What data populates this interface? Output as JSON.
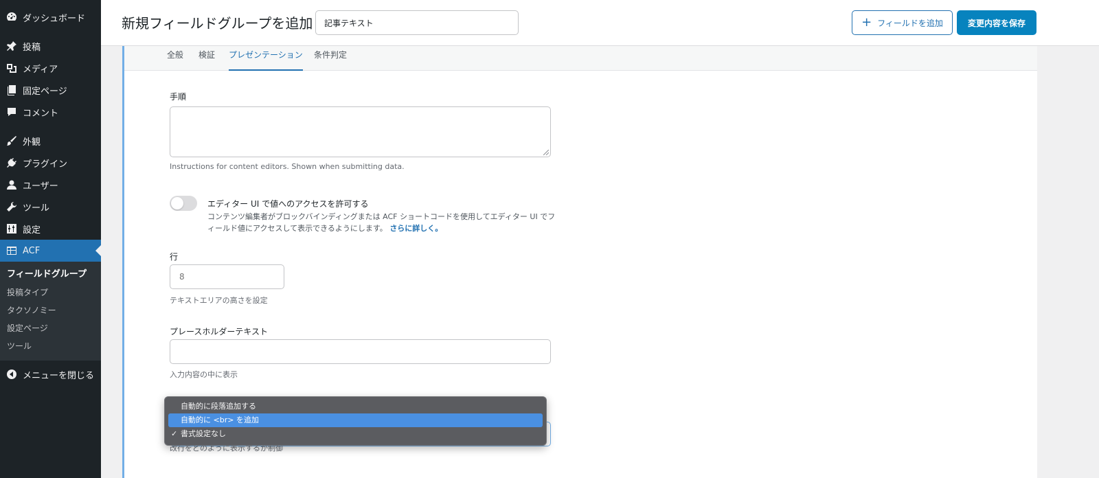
{
  "sidebar": {
    "items": [
      {
        "label": "ダッシュボード",
        "icon": "dashboard-icon"
      },
      {
        "label": "投稿",
        "icon": "pin-icon"
      },
      {
        "label": "メディア",
        "icon": "media-icon"
      },
      {
        "label": "固定ページ",
        "icon": "pages-icon"
      },
      {
        "label": "コメント",
        "icon": "comment-icon"
      },
      {
        "label": "外観",
        "icon": "brush-icon"
      },
      {
        "label": "プラグイン",
        "icon": "plugin-icon"
      },
      {
        "label": "ユーザー",
        "icon": "user-icon"
      },
      {
        "label": "ツール",
        "icon": "wrench-icon"
      },
      {
        "label": "設定",
        "icon": "settings-icon"
      },
      {
        "label": "ACF",
        "icon": "acf-icon"
      }
    ],
    "submenu": [
      "フィールドグループ",
      "投稿タイプ",
      "タクソノミー",
      "設定ページ",
      "ツール"
    ],
    "collapse_label": "メニューを閉じる"
  },
  "header": {
    "title": "新規フィールドグループを追加",
    "group_title_value": "記事テキスト",
    "add_field_label": "フィールドを追加",
    "save_label": "変更内容を保存"
  },
  "tabs": [
    "全般",
    "検証",
    "プレゼンテーション",
    "条件判定"
  ],
  "fields": {
    "instructions_label": "手順",
    "instructions_hint": "Instructions for content editors. Shown when submitting data.",
    "toggle_title": "エディター UI で値へのアクセスを許可する",
    "toggle_desc": "コンテンツ編集者がブロックバインディングまたは ACF ショートコードを使用してエディター UI でフィールド値にアクセスして表示できるようにします。",
    "toggle_link": "さらに詳しく。",
    "rows_label": "行",
    "rows_placeholder": "8",
    "rows_hint": "テキストエリアの高さを設定",
    "placeholder_label": "プレースホルダーテキスト",
    "placeholder_hint": "入力内容の中に表示",
    "newlines_hint": "改行をどのように表示するか制御"
  },
  "dropdown": {
    "options": [
      "自動的に段落追加する",
      "自動的に <br> を追加",
      "書式設定なし"
    ],
    "highlighted_index": 1,
    "checked_index": 2
  },
  "colors": {
    "sidebar_bg": "#1d2327",
    "accent": "#2271b1",
    "save_button": "#0783be"
  }
}
